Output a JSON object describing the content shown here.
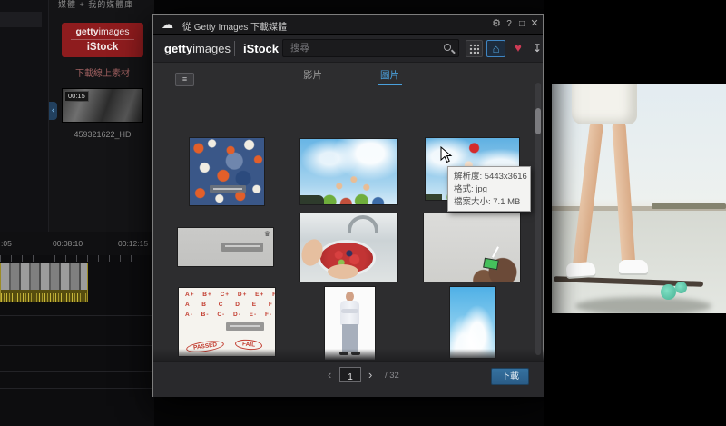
{
  "app": {
    "breadcrumb": "媒體 + 我的媒體庫",
    "media_panel": {
      "logo_getty_bold": "getty",
      "logo_getty_light": "images",
      "logo_istock": "iStock",
      "caption": "下載線上素材",
      "clip_duration": "00:15",
      "clip_name": "459321622_HD",
      "collapse_chevron": "‹"
    },
    "timeline": {
      "ticks": [
        ":05",
        "00:08:10",
        "00:12:15"
      ]
    }
  },
  "dialog": {
    "title": "從 Getty Images 下載媒體",
    "icons": {
      "cloud": "☁",
      "settings": "⚙",
      "help": "?",
      "maximize": "□",
      "close": "✕",
      "view_toggle": "≡",
      "home": "⌂",
      "heart": "♥",
      "library_download": "↧",
      "crown": "♛",
      "star": "★"
    },
    "brand": {
      "getty_bold": "getty",
      "getty_light": "images",
      "istock": "iStock"
    },
    "search_placeholder": "搜尋",
    "tabs": {
      "videos": "影片",
      "photos": "圖片"
    },
    "tooltip": {
      "resolution": "解析度: 5443x3616",
      "format": "格式: jpg",
      "filesize": "檔案大小: 7.1 MB"
    },
    "grades": {
      "row1": "A+ B+ C+ D+ E+ F+",
      "row2": "A B C D E F",
      "row3": "A- B- C- D- E- F-",
      "passed": "PASSED",
      "fail": "FAIL"
    },
    "pagination": {
      "prev": "‹",
      "page_value": "1",
      "next": "›",
      "total": "/ 32"
    },
    "download_label": "下載",
    "colors": {
      "accent_blue": "#4aa0dc",
      "heart_red": "#cf3b55",
      "logo_red": "#8e1c1e",
      "download_button": "#2f6da8"
    }
  }
}
